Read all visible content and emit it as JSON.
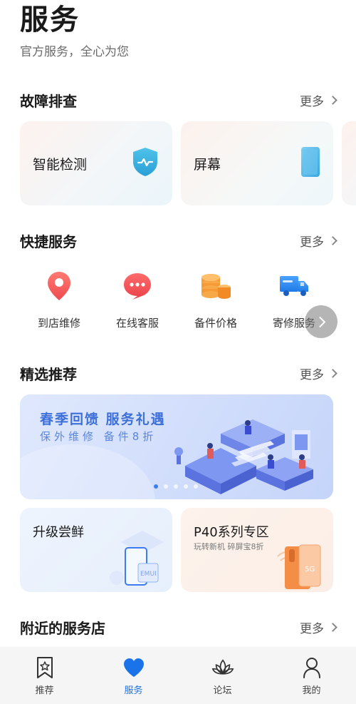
{
  "header": {
    "title": "服务",
    "subtitle": "官方服务，全心为您"
  },
  "troubleshoot": {
    "title": "故障排查",
    "more": "更多",
    "cards": [
      {
        "label": "智能检测",
        "icon": "shield-check-icon"
      },
      {
        "label": "屏幕",
        "icon": "phone-screen-icon"
      },
      {
        "label": "",
        "icon": "partial-card"
      }
    ]
  },
  "quick_services": {
    "title": "快捷服务",
    "more": "更多",
    "items": [
      {
        "label": "到店维修",
        "icon": "location-pin-icon",
        "color": "#f0575c"
      },
      {
        "label": "在线客服",
        "icon": "chat-bubble-icon",
        "color": "#ef4e4e"
      },
      {
        "label": "备件价格",
        "icon": "coin-stack-icon",
        "color": "#f39a35"
      },
      {
        "label": "寄修服务",
        "icon": "delivery-truck-icon",
        "color": "#2f86f0"
      }
    ]
  },
  "recommended": {
    "title": "精选推荐",
    "more": "更多",
    "banner": {
      "title": "春季回馈  服务礼遇",
      "subtitle": "保外维修 备件8折",
      "slides": 5,
      "active_slide": 1
    },
    "promos": [
      {
        "title": "升级尝鲜",
        "subtitle": "",
        "badge": "EMUI"
      },
      {
        "title": "P40系列专区",
        "subtitle": "玩转新机 碎屏宝8折",
        "badge": "5G"
      }
    ]
  },
  "nearby": {
    "title": "附近的服务店",
    "more": "更多"
  },
  "bottom_nav": {
    "items": [
      {
        "label": "推荐",
        "icon": "bookmark-star-icon",
        "active": false
      },
      {
        "label": "服务",
        "icon": "heart-icon",
        "active": true
      },
      {
        "label": "论坛",
        "icon": "lotus-icon",
        "active": false
      },
      {
        "label": "我的",
        "icon": "user-icon",
        "active": false
      }
    ]
  },
  "colors": {
    "accent": "#1a73e8",
    "banner_text": "#3d6fd8"
  }
}
